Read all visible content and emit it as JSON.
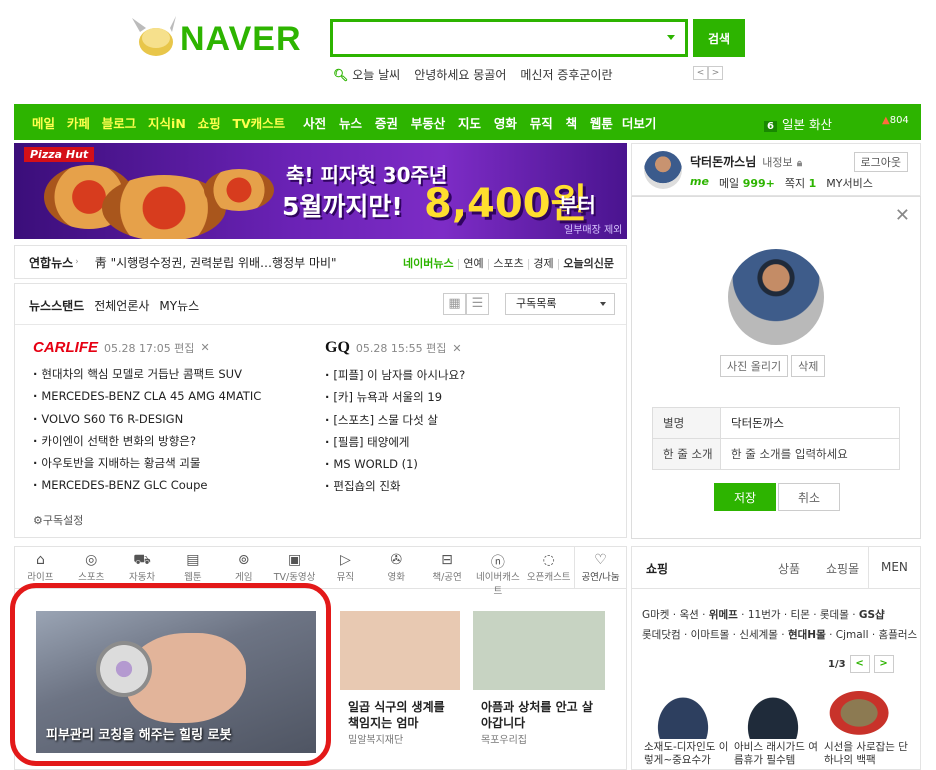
{
  "brand": {
    "logo_text": "NAVER",
    "accent": "#2db400"
  },
  "search": {
    "button_label": "검색",
    "value": ""
  },
  "suggestions": [
    "오늘 날씨",
    "안녕하세요 몽골어",
    "메신저 증후군이란"
  ],
  "pager": {
    "prev": "<",
    "next": ">"
  },
  "nav": {
    "services": [
      "메일",
      "카페",
      "블로그",
      "지식iN",
      "쇼핑",
      "TV캐스트"
    ],
    "sections": [
      "사전",
      "뉴스",
      "증권",
      "부동산",
      "지도",
      "영화",
      "뮤직",
      "책",
      "웹툰"
    ],
    "more": "더보기",
    "weather_num": "6",
    "weather_text": "일본 화산",
    "dust": "804"
  },
  "ad": {
    "brand": "Pizza Hut",
    "line1": "축! 피자헛 30주년",
    "line2": "5월까지만!",
    "price": "8,400원",
    "suffix": "부터",
    "note": "일부매장 제외"
  },
  "newsbar": {
    "source": "연합뉴스",
    "headline": "靑 \"시행령수정권, 권력분립 위배…행정부 마비\"",
    "links": [
      "네이버뉴스",
      "연예",
      "스포츠",
      "경제",
      "오늘의신문"
    ]
  },
  "newsstand": {
    "title": "뉴스스탠드",
    "tabs": [
      "전체언론사",
      "MY뉴스"
    ],
    "select": "구독목록",
    "setting": "구독설정",
    "press": [
      {
        "name": "CARLIFE",
        "time": "05.28 17:05 편집",
        "items": [
          "현대차의 핵심 모델로 거듭난 콤팩트 SUV",
          "MERCEDES-BENZ CLA 45 AMG 4MATIC",
          "VOLVO S60 T6 R-DESIGN",
          "카이엔이 선택한 변화의 방향은?",
          "아우토반을 지배하는 황금색 괴물",
          "MERCEDES-BENZ GLC Coupe"
        ]
      },
      {
        "name": "GQ",
        "time": "05.28 15:55 편집",
        "items": [
          "[피플] 이 남자를 아시나요?",
          "[카] 뉴욕과 서울의 19",
          "[스포츠] 스물 다섯 살",
          "[필름] 태양에게",
          "MS WORLD (1)",
          "편집숍의 진화"
        ]
      }
    ]
  },
  "login": {
    "nickname": "닥터돈까스님",
    "edit": "내정보",
    "logout": "로그아웃",
    "me": "me",
    "mail_label": "메일",
    "mail_count": "999+",
    "note_label": "쪽지",
    "note_count": "1",
    "services": "MY서비스"
  },
  "profile": {
    "upload": "사진 올리기",
    "delete": "삭제",
    "alias_label": "별명",
    "alias_value": "닥터돈까스",
    "intro_label": "한 줄 소개",
    "intro_placeholder": "한 줄 소개를 입력하세요",
    "save": "저장",
    "cancel": "취소"
  },
  "cast": {
    "tabs": [
      "라이프",
      "스포츠",
      "자동차",
      "웹툰",
      "게임",
      "TV/동영상",
      "뮤직",
      "영화",
      "책/공연",
      "네이버캐스트",
      "오픈캐스트",
      "공연/나눔"
    ],
    "cards": [
      {
        "title": "피부관리 코칭을 해주는 힐링 로봇"
      },
      {
        "title": "일곱 식구의 생계를 책임지는 엄마",
        "source": "밀알복지재단"
      },
      {
        "title": "아픔과 상처를 안고 살아갑니다",
        "source": "목포우리집"
      }
    ]
  },
  "shopping": {
    "title": "쇼핑",
    "tabs": [
      "상품",
      "쇼핑몰",
      "MEN"
    ],
    "malls_line1": [
      "G마켓",
      "옥션",
      "위메프",
      "11번가",
      "티몬",
      "롯데몰",
      "GS샵"
    ],
    "malls_line2": [
      "롯데닷컴",
      "이마트몰",
      "신세계몰",
      "현대H몰",
      "Cjmall",
      "홈플러스"
    ],
    "page": "1/3",
    "products": [
      "소재도-디자인도 이렇게~중요수가",
      "아비스 래시가드 여름휴가 필수템",
      "시선을 사로잡는 단 하나의 백팩"
    ]
  }
}
